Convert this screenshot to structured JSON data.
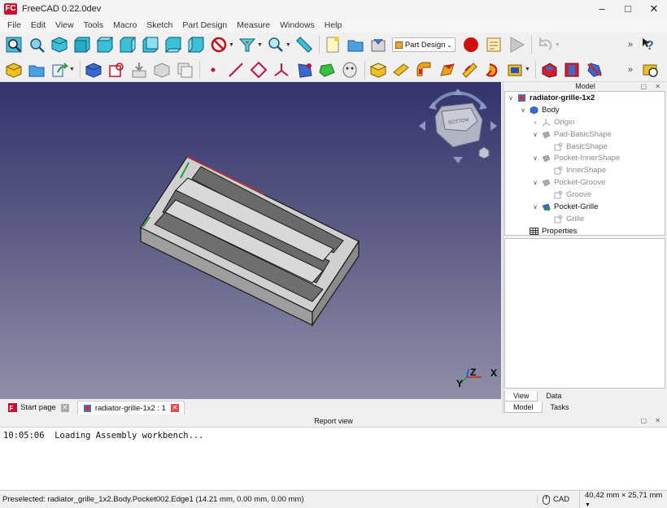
{
  "window": {
    "title": "FreeCAD 0.22.0dev",
    "logo": "FC",
    "controls": [
      "–",
      "□",
      "✕"
    ]
  },
  "menu": [
    "File",
    "Edit",
    "View",
    "Tools",
    "Macro",
    "Sketch",
    "Part Design",
    "Measure",
    "Windows",
    "Help"
  ],
  "toolbar": {
    "workbench": "Part Design",
    "overflow": "»"
  },
  "model_panel": {
    "title": "Model",
    "tree": [
      {
        "label": "radiator-grille-1x2",
        "level": 0,
        "expander": "∨",
        "style": "bold",
        "icon": "document-icon"
      },
      {
        "label": "Body",
        "level": 1,
        "expander": "∨",
        "style": "normal",
        "icon": "body-icon"
      },
      {
        "label": "Origin",
        "level": 2,
        "expander": "›",
        "style": "grey",
        "icon": "origin-icon"
      },
      {
        "label": "Pad-BasicShape",
        "level": 2,
        "expander": "∨",
        "style": "grey",
        "icon": "pad-icon"
      },
      {
        "label": "BasicShape",
        "level": 3,
        "expander": "",
        "style": "grey",
        "icon": "sketch-icon"
      },
      {
        "label": "Pocket-InnerShape",
        "level": 2,
        "expander": "∨",
        "style": "grey",
        "icon": "pocket-icon"
      },
      {
        "label": "InnerShape",
        "level": 3,
        "expander": "",
        "style": "grey",
        "icon": "sketch-icon"
      },
      {
        "label": "Pocket-Groove",
        "level": 2,
        "expander": "∨",
        "style": "grey",
        "icon": "pocket-icon"
      },
      {
        "label": "Groove",
        "level": 3,
        "expander": "",
        "style": "grey",
        "icon": "sketch-icon"
      },
      {
        "label": "Pocket-Grille",
        "level": 2,
        "expander": "∨",
        "style": "normal",
        "icon": "pocket-tip-icon"
      },
      {
        "label": "Grille",
        "level": 3,
        "expander": "",
        "style": "grey",
        "icon": "sketch-icon"
      },
      {
        "label": "Properties",
        "level": 0,
        "expander": "",
        "style": "normal",
        "icon": "table-icon"
      }
    ],
    "subtabs": [
      "View",
      "Data"
    ],
    "tabs": [
      "Model",
      "Tasks"
    ]
  },
  "document_tabs": [
    {
      "label": "Start page",
      "icon": "freecad-icon",
      "close": "✕"
    },
    {
      "label": "radiator-grille-1x2 : 1",
      "icon": "document-icon",
      "close": "✕"
    }
  ],
  "report": {
    "title": "Report view",
    "lines": [
      "10:05:06  Loading Assembly workbench..."
    ]
  },
  "status": {
    "message": "Preselected: radiator_grille_1x2.Body.Pocket002.Edge1 (14.21 mm, 0.00 mm, 0.00 mm)",
    "navigation": "CAD",
    "dimensions": "40,42 mm × 25,71 mm"
  },
  "navcube": {
    "face": "BOTTOM"
  },
  "axes": {
    "x": "X",
    "y": "Y",
    "z": "Z"
  },
  "colors": {
    "viewport_top": "#33336d",
    "viewport_bottom": "#8f8fa8",
    "record": "#d01010",
    "axis_x": "#d02020",
    "axis_y": "#20a020",
    "axis_z": "#2050d0"
  }
}
